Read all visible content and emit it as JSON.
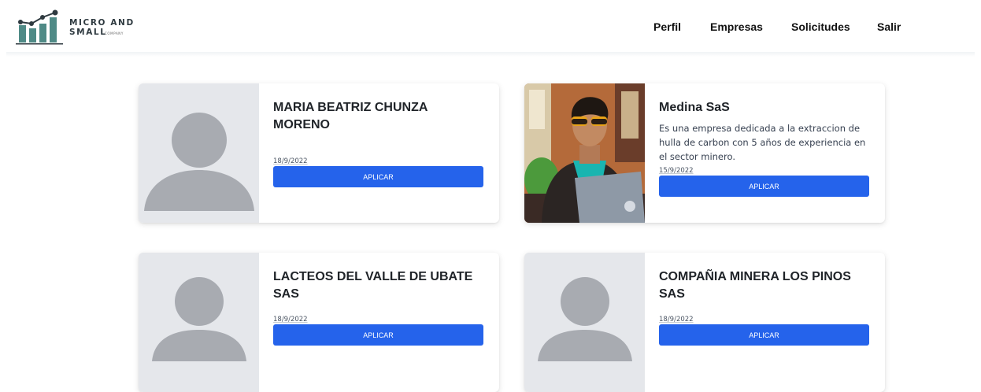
{
  "brand": {
    "name": "MICRO AND SMALL",
    "subtitle": "COMPANY",
    "logo_icon": "bar-chart-growth-icon",
    "color": "#4f8a86"
  },
  "nav": {
    "items": [
      {
        "label": "Perfil"
      },
      {
        "label": "Empresas"
      },
      {
        "label": "Solicitudes"
      },
      {
        "label": "Salir"
      }
    ]
  },
  "colors": {
    "accent": "#2563eb",
    "placeholder_bg": "#e5e7eb",
    "placeholder_fg": "#a8abb1"
  },
  "cards": [
    {
      "title": "MARIA BEATRIZ CHUNZA MORENO",
      "description": "",
      "date": "18/9/2022",
      "button": "APLICAR",
      "image": "avatar-placeholder"
    },
    {
      "title": "Medina SaS",
      "description": "Es una empresa dedicada a la extraccion de hulla de carbon con 5 años de experiencia en el sector minero.",
      "date": "15/9/2022",
      "button": "APLICAR",
      "image": "person-photo"
    },
    {
      "title": "LACTEOS DEL VALLE DE UBATE SAS",
      "description": "",
      "date": "18/9/2022",
      "button": "APLICAR",
      "image": "avatar-placeholder"
    },
    {
      "title": "COMPAÑIA MINERA LOS PINOS SAS",
      "description": "",
      "date": "18/9/2022",
      "button": "APLICAR",
      "image": "avatar-placeholder"
    }
  ]
}
